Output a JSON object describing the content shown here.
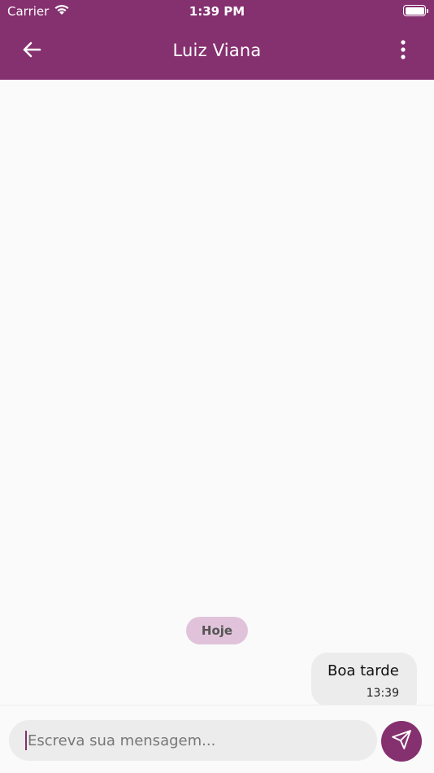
{
  "status_bar": {
    "carrier": "Carrier",
    "time": "1:39 PM",
    "wifi_icon": "wifi-icon",
    "battery_icon": "battery-icon"
  },
  "app_bar": {
    "title": "Luiz Viana",
    "back_icon": "arrow-left-icon",
    "menu_icon": "more-vertical-icon",
    "background_color": "#85306f"
  },
  "chat": {
    "date_separator": "Hoje",
    "messages": [
      {
        "text": "Boa tarde",
        "time": "13:39",
        "sender": "me"
      }
    ]
  },
  "composer": {
    "placeholder": "Escreva sua mensagem...",
    "send_icon": "send-icon",
    "accent_color": "#85306f"
  }
}
